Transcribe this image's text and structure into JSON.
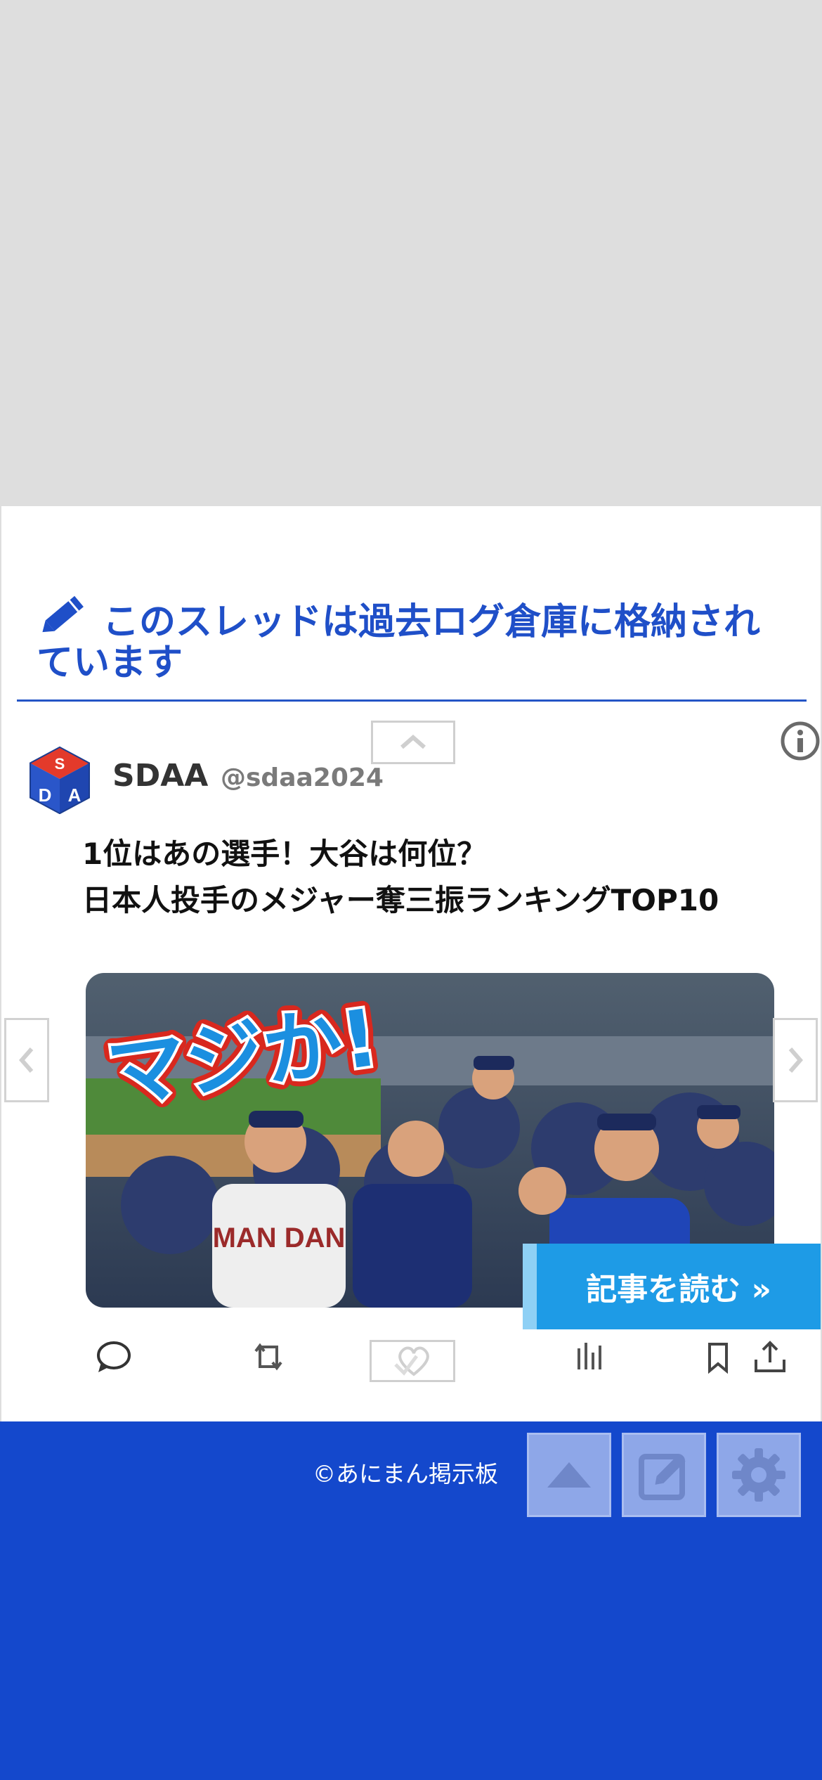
{
  "notice": {
    "text": "このスレッドは過去ログ倉庫に格納されています"
  },
  "post": {
    "account_name": "SDAA",
    "account_handle": "@sdaa2024",
    "avatar_text": "SDA",
    "headline_line1": "1位はあの選手！大谷は何位？",
    "headline_line2": "日本人投手のメジャー奪三振ランキングTOP10",
    "image_caption": "マジか!",
    "jersey_text": "MAN DAN",
    "read_button": "記事を読む »"
  },
  "footer": {
    "copyright": "©あにまん掲示板"
  },
  "colors": {
    "accent_blue": "#1f4fc8",
    "footer_blue": "#1448cc",
    "button_blue": "#1e9be6"
  }
}
